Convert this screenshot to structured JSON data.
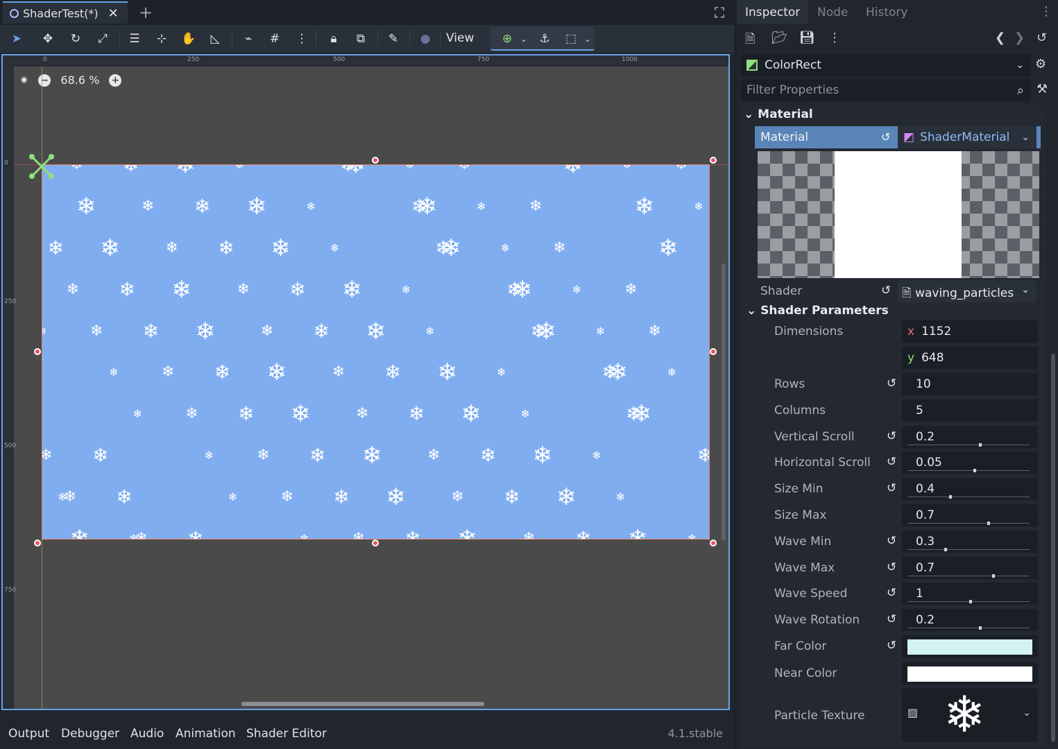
{
  "scene_tabs": {
    "active": "ShaderTest(*)",
    "close": "✕",
    "add": "+"
  },
  "toolbar": {
    "view_label": "View"
  },
  "viewport": {
    "zoom": "68.6 %",
    "ruler_top": [
      "0",
      "250",
      "500",
      "750",
      "1000"
    ],
    "ruler_left": [
      "0",
      "250",
      "500",
      "750"
    ]
  },
  "bottom_tabs": [
    "Output",
    "Debugger",
    "Audio",
    "Animation",
    "Shader Editor"
  ],
  "version": "4.1.stable",
  "inspector": {
    "tabs": [
      "Inspector",
      "Node",
      "History"
    ],
    "node_name": "ColorRect",
    "filter_placeholder": "Filter Properties",
    "section": "Material",
    "material_label": "Material",
    "material_value": "ShaderMaterial",
    "shader_label": "Shader",
    "shader_value": "waving_particles",
    "shader_params_head": "Shader Parameters",
    "dimensions": {
      "label": "Dimensions",
      "x_label": "x",
      "x": "1152",
      "y_label": "y",
      "y": "648"
    },
    "params": [
      {
        "name": "Rows",
        "value": "10",
        "revert": true,
        "slider": null
      },
      {
        "name": "Columns",
        "value": "5",
        "revert": false,
        "slider": null
      },
      {
        "name": "Vertical Scroll",
        "value": "0.2",
        "revert": true,
        "slider": 0.6
      },
      {
        "name": "Horizontal Scroll",
        "value": "0.05",
        "revert": true,
        "slider": 0.55
      },
      {
        "name": "Size Min",
        "value": "0.4",
        "revert": true,
        "slider": 0.35
      },
      {
        "name": "Size Max",
        "value": "0.7",
        "revert": false,
        "slider": 0.67
      },
      {
        "name": "Wave Min",
        "value": "0.3",
        "revert": true,
        "slider": 0.31
      },
      {
        "name": "Wave Max",
        "value": "0.7",
        "revert": true,
        "slider": 0.71
      },
      {
        "name": "Wave Speed",
        "value": "1",
        "revert": true,
        "slider": 0.52
      },
      {
        "name": "Wave Rotation",
        "value": "0.2",
        "revert": true,
        "slider": 0.6
      }
    ],
    "far_color": {
      "label": "Far Color",
      "color": "#d2f3f2"
    },
    "near_color": {
      "label": "Near Color",
      "color": "#ffffff"
    },
    "particle_texture": {
      "label": "Particle Texture"
    }
  }
}
